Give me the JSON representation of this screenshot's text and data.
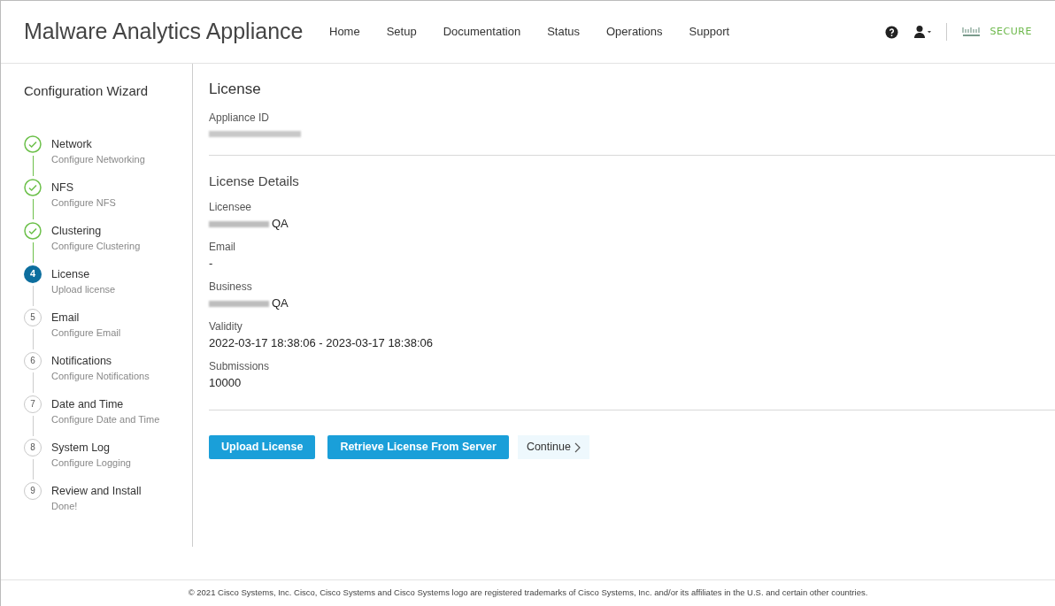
{
  "header": {
    "title": "Malware Analytics Appliance",
    "nav": [
      {
        "label": "Home"
      },
      {
        "label": "Setup"
      },
      {
        "label": "Documentation"
      },
      {
        "label": "Status"
      },
      {
        "label": "Operations"
      },
      {
        "label": "Support"
      }
    ],
    "brand": "SECURE"
  },
  "sidebar": {
    "title": "Configuration Wizard",
    "steps": [
      {
        "label": "Network",
        "sublabel": "Configure Networking",
        "kind": "done"
      },
      {
        "label": "NFS",
        "sublabel": "Configure NFS",
        "kind": "done"
      },
      {
        "label": "Clustering",
        "sublabel": "Configure Clustering",
        "kind": "done"
      },
      {
        "label": "License",
        "sublabel": "Upload license",
        "kind": "current",
        "number": "4"
      },
      {
        "label": "Email",
        "sublabel": "Configure Email",
        "kind": "pending",
        "number": "5"
      },
      {
        "label": "Notifications",
        "sublabel": "Configure Notifications",
        "kind": "pending",
        "number": "6"
      },
      {
        "label": "Date and Time",
        "sublabel": "Configure Date and Time",
        "kind": "pending",
        "number": "7"
      },
      {
        "label": "System Log",
        "sublabel": "Configure Logging",
        "kind": "pending",
        "number": "8"
      },
      {
        "label": "Review and Install",
        "sublabel": "Done!",
        "kind": "pending",
        "number": "9"
      }
    ]
  },
  "main": {
    "title": "License",
    "appliance": {
      "label": "Appliance ID",
      "redacted": true
    },
    "details_title": "License Details",
    "fields": [
      {
        "label": "Licensee",
        "value": "QA",
        "redacted": true
      },
      {
        "label": "Email",
        "value": "-",
        "redacted": false
      },
      {
        "label": "Business",
        "value": "QA",
        "redacted": true
      },
      {
        "label": "Validity",
        "value": "2022-03-17 18:38:06 - 2023-03-17 18:38:06",
        "redacted": false
      },
      {
        "label": "Submissions",
        "value": "10000",
        "redacted": false
      }
    ],
    "buttons": [
      {
        "label": "Upload License",
        "kind": "primary"
      },
      {
        "label": "Retrieve License From Server",
        "kind": "primary"
      },
      {
        "label": "Continue",
        "kind": "link"
      }
    ]
  },
  "footer": "© 2021 Cisco Systems, Inc. Cisco, Cisco Systems and Cisco Systems logo are registered trademarks of Cisco Systems, Inc. and/or its affiliates in the U.S. and certain other countries."
}
